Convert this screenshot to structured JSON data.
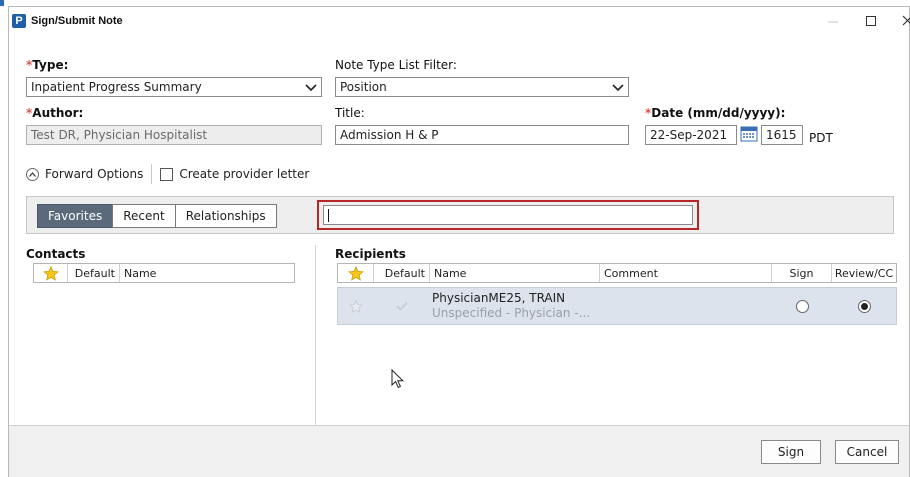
{
  "window": {
    "app_icon_letter": "P",
    "title": "Sign/Submit Note"
  },
  "form": {
    "type": {
      "required_mark": "*",
      "label": "Type:",
      "value": "Inpatient Progress Summary"
    },
    "note_type_filter": {
      "label": "Note Type List Filter:",
      "value": "Position"
    },
    "author": {
      "required_mark": "*",
      "label": "Author:",
      "value": "Test DR, Physician Hospitalist"
    },
    "title": {
      "label": "Title:",
      "value": "Admission H & P"
    },
    "date": {
      "required_mark": "*",
      "label": "Date (mm/dd/yyyy):",
      "value": "22-Sep-2021",
      "time": "1615",
      "timezone": "PDT"
    }
  },
  "options": {
    "forward_options_label": "Forward Options",
    "create_provider_letter_label": "Create provider letter"
  },
  "tabs": [
    {
      "label": "Favorites",
      "active": true
    },
    {
      "label": "Recent",
      "active": false
    },
    {
      "label": "Relationships",
      "active": false
    }
  ],
  "search": {
    "value": ""
  },
  "contacts": {
    "title": "Contacts",
    "columns": [
      "",
      "Default",
      "Name"
    ]
  },
  "recipients": {
    "title": "Recipients",
    "columns": [
      "",
      "Default",
      "Name",
      "Comment",
      "Sign",
      "Review/CC"
    ],
    "rows": [
      {
        "name": "PhysicianME25, TRAIN",
        "sub": "Unspecified - Physician -...",
        "comment": "",
        "sign": false,
        "review_cc": true
      }
    ]
  },
  "footer": {
    "sign_label": "Sign",
    "cancel_label": "Cancel"
  },
  "colors": {
    "required": "#d9534f",
    "active_tab": "#5b6a7a",
    "highlight": "#b52828",
    "selected_row": "#dde3ec",
    "app_icon": "#1f5fa8"
  }
}
